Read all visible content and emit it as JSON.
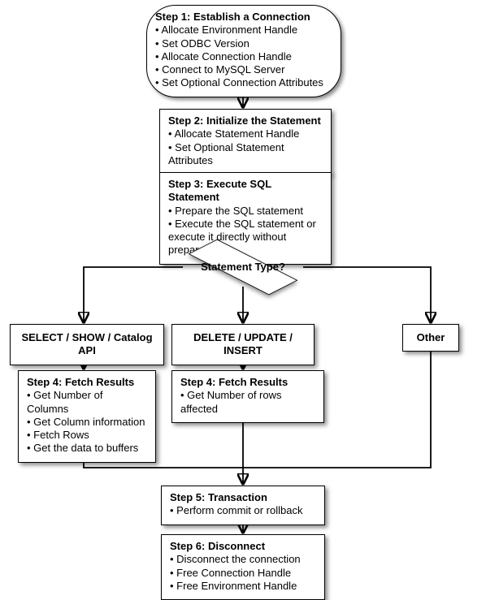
{
  "step1": {
    "title": "Step 1: Establish a Connection",
    "items": [
      "Allocate Environment Handle",
      "Set ODBC Version",
      "Allocate Connection Handle",
      "Connect to MySQL Server",
      "Set Optional Connection Attributes"
    ]
  },
  "step2": {
    "title": "Step 2: Initialize the Statement",
    "items": [
      "Allocate Statement Handle",
      "Set Optional Statement Attributes"
    ]
  },
  "step3": {
    "title": "Step 3: Execute SQL Statement",
    "items": [
      "Prepare the SQL statement",
      "Execute the SQL statement or execute it directly without prepare"
    ]
  },
  "decision": {
    "label": "Statement Type?"
  },
  "branch_left": {
    "label": "SELECT / SHOW / Catalog API"
  },
  "branch_mid": {
    "label": "DELETE / UPDATE / INSERT"
  },
  "branch_right": {
    "label": "Other"
  },
  "step4_left": {
    "title": "Step 4: Fetch Results",
    "items": [
      "Get Number of Columns",
      "Get Column information",
      "Fetch Rows",
      "Get the data to buffers"
    ]
  },
  "step4_mid": {
    "title": "Step 4: Fetch Results",
    "items": [
      "Get Number of rows affected"
    ]
  },
  "step5": {
    "title": "Step 5: Transaction",
    "items": [
      "Perform commit or rollback"
    ]
  },
  "step6": {
    "title": "Step 6: Disconnect",
    "items": [
      "Disconnect the connection",
      "Free Connection Handle",
      "Free Environment Handle"
    ]
  }
}
